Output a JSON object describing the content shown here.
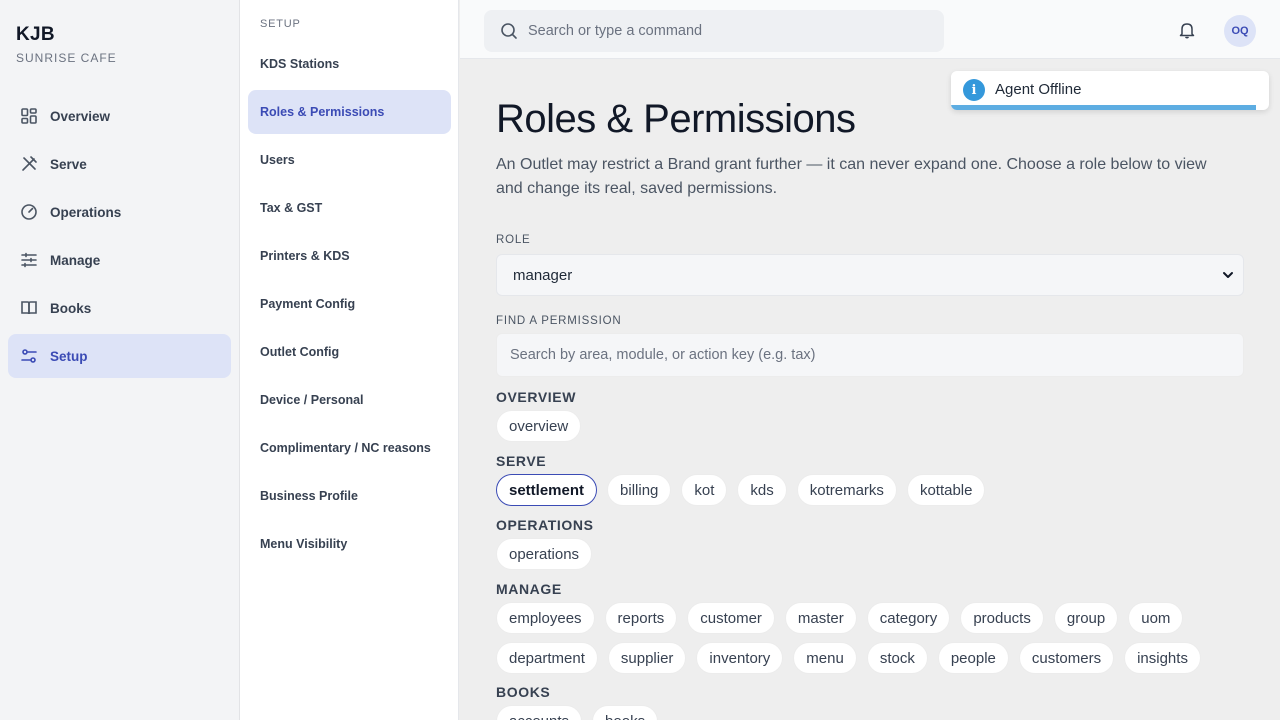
{
  "brand": {
    "name": "KJB",
    "outlet": "SUNRISE CAFE"
  },
  "nav": [
    {
      "label": "Overview",
      "icon": "grid-icon",
      "active": false
    },
    {
      "label": "Serve",
      "icon": "utensils-icon",
      "active": false
    },
    {
      "label": "Operations",
      "icon": "gauge-icon",
      "active": false
    },
    {
      "label": "Manage",
      "icon": "sliders-icon",
      "active": false
    },
    {
      "label": "Books",
      "icon": "book-icon",
      "active": false
    },
    {
      "label": "Setup",
      "icon": "settings-icon",
      "active": true
    }
  ],
  "setup": {
    "heading": "SETUP",
    "items": [
      {
        "label": "KDS Stations",
        "active": false
      },
      {
        "label": "Roles & Permissions",
        "active": true
      },
      {
        "label": "Users",
        "active": false
      },
      {
        "label": "Tax & GST",
        "active": false
      },
      {
        "label": "Printers & KDS",
        "active": false
      },
      {
        "label": "Payment Config",
        "active": false
      },
      {
        "label": "Outlet Config",
        "active": false
      },
      {
        "label": "Device / Personal",
        "active": false
      },
      {
        "label": "Complimentary / NC reasons",
        "active": false
      },
      {
        "label": "Business Profile",
        "active": false
      },
      {
        "label": "Menu Visibility",
        "active": false
      }
    ]
  },
  "topbar": {
    "search_placeholder": "Search or type a command",
    "avatar_initials": "OQ"
  },
  "toast": {
    "text": "Agent Offline",
    "icon": "info-icon",
    "progress": 0.96,
    "color": "#3498db"
  },
  "main": {
    "title": "Roles & Permissions",
    "description": "An Outlet may restrict a Brand grant further — it can never expand one. Choose a role below to view and change its real, saved permissions.",
    "role_label": "ROLE",
    "role_value": "manager",
    "find_label": "FIND A PERMISSION",
    "find_placeholder": "Search by area, module, or action key (e.g. tax)",
    "groups": [
      {
        "title": "OVERVIEW",
        "chips": [
          "overview"
        ]
      },
      {
        "title": "SERVE",
        "chips": [
          "settlement",
          "billing",
          "kot",
          "kds",
          "kotremarks",
          "kottable"
        ],
        "selected": "settlement"
      },
      {
        "title": "OPERATIONS",
        "chips": [
          "operations"
        ]
      },
      {
        "title": "MANAGE",
        "chips": [
          "employees",
          "reports",
          "customer",
          "master",
          "category",
          "products",
          "group",
          "uom",
          "department",
          "supplier",
          "inventory",
          "menu",
          "stock",
          "people",
          "customers",
          "insights"
        ]
      },
      {
        "title": "BOOKS",
        "chips": [
          "accounts",
          "books"
        ]
      }
    ]
  },
  "colors": {
    "accent": "#3b4bb5",
    "active_bg": "#dde3f7"
  }
}
